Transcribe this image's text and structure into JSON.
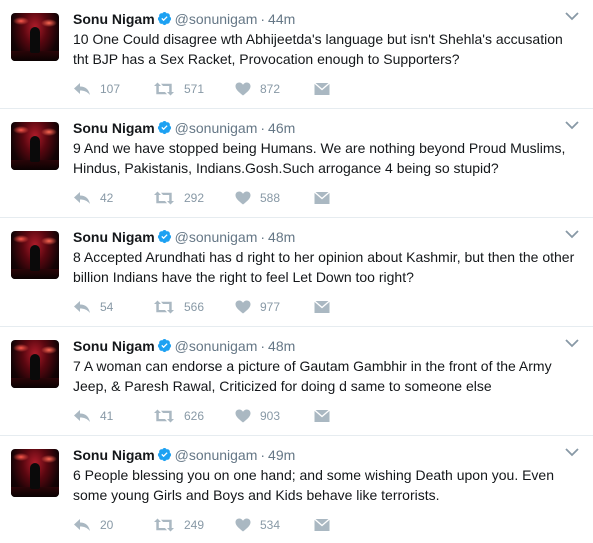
{
  "colors": {
    "name": "#14171a",
    "secondary": "#657786",
    "action": "#8899a6",
    "verified": "#1da1f2",
    "divider": "#e6ecf0"
  },
  "icons": {
    "verified": "verified-badge-icon",
    "caret": "chevron-down-icon",
    "reply": "reply-icon",
    "retweet": "retweet-icon",
    "like": "heart-icon",
    "dm": "direct-message-icon"
  },
  "tweets": [
    {
      "name": "Sonu Nigam",
      "handle": "@sonunigam",
      "dot": "·",
      "time": "44m",
      "text": "10 One Could disagree wth Abhijeetda's language but isn't Shehla's accusation tht BJP has a Sex Racket, Provocation enough to Supporters?",
      "replies": "107",
      "retweets": "571",
      "likes": "872"
    },
    {
      "name": "Sonu Nigam",
      "handle": "@sonunigam",
      "dot": "·",
      "time": "46m",
      "text": "9 And we have stopped being Humans. We are nothing beyond Proud Muslims, Hindus, Pakistanis, Indians.Gosh.Such arrogance 4 being so stupid?",
      "replies": "42",
      "retweets": "292",
      "likes": "588"
    },
    {
      "name": "Sonu Nigam",
      "handle": "@sonunigam",
      "dot": "·",
      "time": "48m",
      "text": "8 Accepted Arundhati has d right to her opinion about Kashmir, but then the other billion Indians have the right to feel Let Down too right?",
      "replies": "54",
      "retweets": "566",
      "likes": "977"
    },
    {
      "name": "Sonu Nigam",
      "handle": "@sonunigam",
      "dot": "·",
      "time": "48m",
      "text": "7 A woman can endorse a picture of Gautam Gambhir in the front of the Army Jeep, & Paresh Rawal, Criticized for doing d same to someone else",
      "replies": "41",
      "retweets": "626",
      "likes": "903"
    },
    {
      "name": "Sonu Nigam",
      "handle": "@sonunigam",
      "dot": "·",
      "time": "49m",
      "text": "6 People blessing you on one hand; and some wishing Death upon you. Even some young Girls and Boys and Kids behave like terrorists.",
      "replies": "20",
      "retweets": "249",
      "likes": "534"
    }
  ]
}
